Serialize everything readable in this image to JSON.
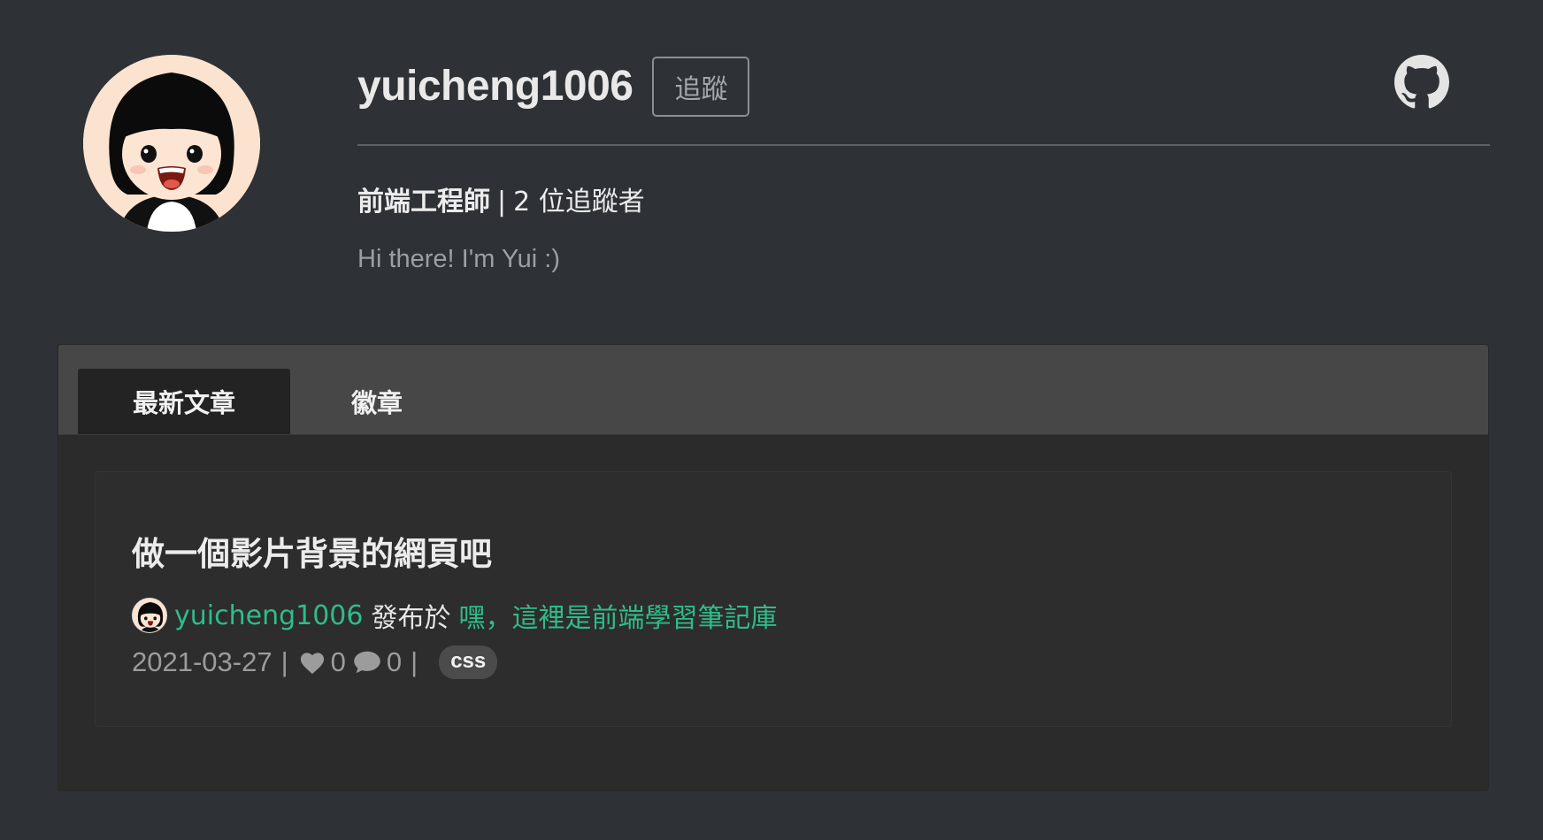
{
  "profile": {
    "username": "yuicheng1006",
    "follow_label": "追蹤",
    "title": "前端工程師",
    "separator": "|",
    "followers_text": "2 位追蹤者",
    "bio": "Hi there! I'm Yui :)",
    "avatar_icon": "avatar-girl-bob-haircut",
    "github_icon": "github-icon"
  },
  "tabs": [
    {
      "label": "最新文章",
      "active": true
    },
    {
      "label": "徽章",
      "active": false
    }
  ],
  "post": {
    "title": "做一個影片背景的網頁吧",
    "author": "yuicheng1006",
    "published_in_label": "發布於",
    "publication": "嘿，這裡是前端學習筆記庫",
    "date": "2021-03-27",
    "likes": "0",
    "comments": "0",
    "tag": "css"
  },
  "colors": {
    "background": "#2e3236",
    "accent_green": "#2fbc8a",
    "panel": "#2b2b2b",
    "tab_bar": "#474747"
  }
}
